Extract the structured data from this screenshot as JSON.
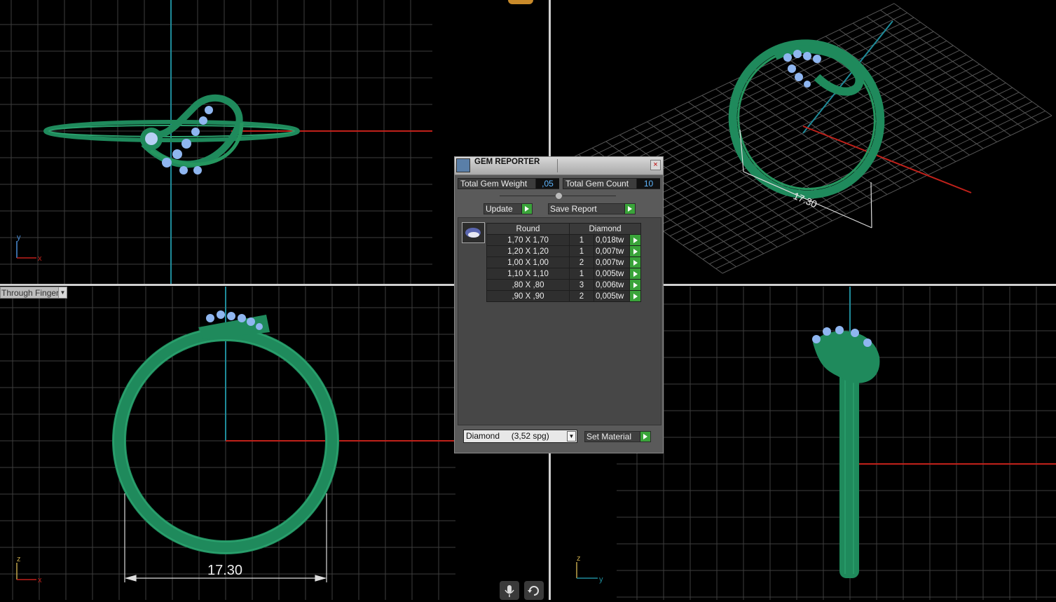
{
  "viewport": {
    "display_mode": "Through Finger"
  },
  "dimensions": {
    "front": "17.30",
    "perspective": "17.30"
  },
  "axes": {
    "top_left": {
      "v": "y",
      "h": "x"
    },
    "bottom_left": {
      "v": "z",
      "h": "x"
    },
    "bottom_right": {
      "v": "z",
      "h": "y"
    }
  },
  "gem_reporter": {
    "title": "GEM REPORTER",
    "close": "×",
    "total_weight_label": "Total Gem Weight",
    "total_weight_value": ",05",
    "total_count_label": "Total Gem Count",
    "total_count_value": "10",
    "update_label": "Update",
    "save_label": "Save Report",
    "table": {
      "shape_header": "Round",
      "material_header": "Diamond",
      "rows": [
        {
          "size": "1,70 X 1,70",
          "count": "1",
          "weight": "0,018tw"
        },
        {
          "size": "1,20 X 1,20",
          "count": "1",
          "weight": "0,007tw"
        },
        {
          "size": "1,00 X 1,00",
          "count": "2",
          "weight": "0,007tw"
        },
        {
          "size": "1,10 X 1,10",
          "count": "1",
          "weight": "0,005tw"
        },
        {
          "size": ",80 X ,80",
          "count": "3",
          "weight": "0,006tw"
        },
        {
          "size": ",90 X ,90",
          "count": "2",
          "weight": "0,005tw"
        }
      ]
    },
    "material_select": "Diamond     (3,52 spg)",
    "set_material_label": "Set Material"
  },
  "colors": {
    "ring": "#1f8a5c",
    "gem": "#8fb6f0",
    "grid": "#3e3e3e",
    "axis_x": "#c0211a",
    "axis_v": "#1f8b9a"
  }
}
